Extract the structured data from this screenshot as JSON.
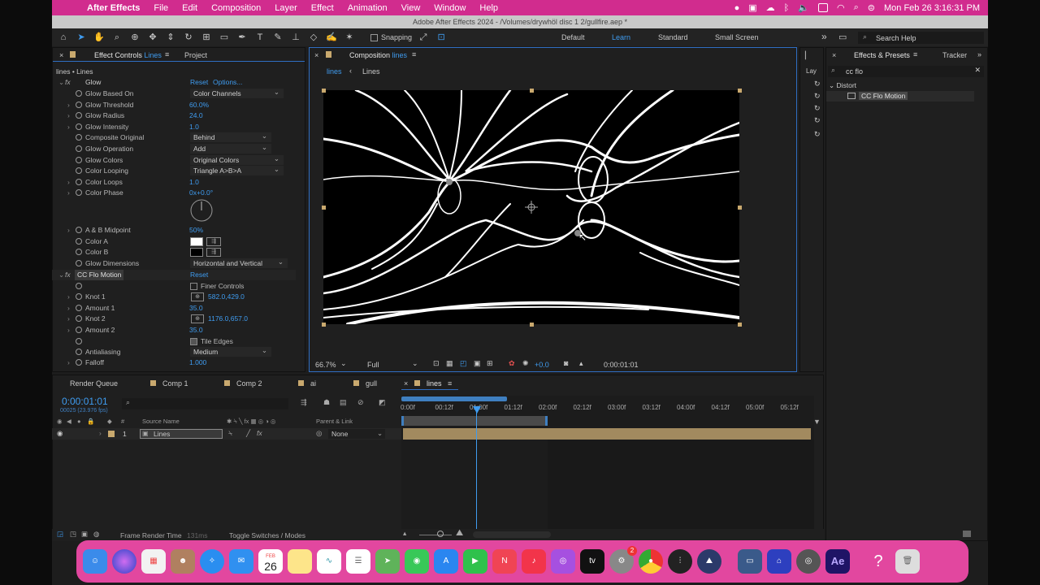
{
  "menubar": {
    "app_name": "After Effects",
    "items": [
      "File",
      "Edit",
      "Composition",
      "Layer",
      "Effect",
      "Animation",
      "View",
      "Window",
      "Help"
    ],
    "clock": "Mon Feb 26  3:16:31 PM"
  },
  "window_title": "Adobe After Effects 2024 - /Volumes/drywhöl disc 1 2/gullfire.aep *",
  "toolbar": {
    "snapping_label": "Snapping",
    "workspaces": [
      "Default",
      "Learn",
      "Standard",
      "Small Screen"
    ],
    "active_workspace": "Learn",
    "search_placeholder": "Search Help"
  },
  "effect_controls": {
    "tab_label": "Effect Controls",
    "tab_layer": "Lines",
    "project_tab": "Project",
    "breadcrumb": "lines • Lines",
    "glow": {
      "name": "Glow",
      "reset": "Reset",
      "options": "Options...",
      "props": [
        {
          "name": "Glow Based On",
          "type": "dropdown",
          "value": "Color Channels"
        },
        {
          "name": "Glow Threshold",
          "type": "value",
          "value": "60.0%"
        },
        {
          "name": "Glow Radius",
          "type": "value",
          "value": "24.0"
        },
        {
          "name": "Glow Intensity",
          "type": "value",
          "value": "1.0"
        },
        {
          "name": "Composite Original",
          "type": "dropdown",
          "value": "Behind"
        },
        {
          "name": "Glow Operation",
          "type": "dropdown",
          "value": "Add"
        },
        {
          "name": "Glow Colors",
          "type": "dropdown",
          "value": "Original Colors"
        },
        {
          "name": "Color Looping",
          "type": "dropdown",
          "value": "Triangle A>B>A"
        },
        {
          "name": "Color Loops",
          "type": "value",
          "value": "1.0"
        },
        {
          "name": "Color Phase",
          "type": "value",
          "value": "0x+0.0°"
        }
      ],
      "props2": [
        {
          "name": "A & B Midpoint",
          "type": "value",
          "value": "50%"
        },
        {
          "name": "Color A",
          "type": "swatch",
          "value": "#ffffff"
        },
        {
          "name": "Color B",
          "type": "swatch",
          "value": "#000000"
        },
        {
          "name": "Glow Dimensions",
          "type": "dropdown",
          "value": "Horizontal and Vertical"
        }
      ]
    },
    "flo": {
      "name": "CC Flo Motion",
      "reset": "Reset",
      "finer_controls": "Finer Controls",
      "props": [
        {
          "name": "Knot 1",
          "type": "point",
          "value": "582.0,429.0"
        },
        {
          "name": "Amount 1",
          "type": "value",
          "value": "35.0"
        },
        {
          "name": "Knot 2",
          "type": "point",
          "value": "1176.0,657.0"
        },
        {
          "name": "Amount 2",
          "type": "value",
          "value": "35.0"
        }
      ],
      "tile_edges": "Tile Edges",
      "antialiasing": {
        "name": "Antialiasing",
        "value": "Medium"
      },
      "falloff": {
        "name": "Falloff",
        "value": "1.000"
      }
    }
  },
  "composition": {
    "tab_label": "Composition",
    "tab_name": "lines",
    "nav_items": [
      "lines",
      "Lines"
    ],
    "zoom": "66.7%",
    "resolution": "Full",
    "exposure": "+0.0",
    "timecode": "0:00:01:01"
  },
  "effects_presets": {
    "tab_label": "Effects & Presets",
    "tracker_tab": "Tracker",
    "search_value": "cc flo",
    "category": "Distort",
    "result": "CC Flo Motion",
    "layer_tab": "Lay"
  },
  "timeline": {
    "tabs": [
      "Render Queue",
      "Comp 1",
      "Comp 2",
      "ai",
      "gull",
      "lines"
    ],
    "active_tab": "lines",
    "timecode": "0:00:01:01",
    "fps": "00025 (23.976 fps)",
    "columns": {
      "source": "Source Name",
      "parent": "Parent & Link"
    },
    "layer": {
      "index": "1",
      "name": "Lines",
      "parent": "None"
    },
    "ruler": [
      "0:00f",
      "00:12f",
      "01:00f",
      "01:12f",
      "02:00f",
      "02:12f",
      "03:00f",
      "03:12f",
      "04:00f",
      "04:12f",
      "05:00f",
      "05:12f"
    ],
    "footer": {
      "render_time_label": "Frame Render Time",
      "render_time": "131ms",
      "toggle": "Toggle Switches / Modes"
    }
  },
  "dock": {
    "apps": [
      "finder-icon",
      "siri-icon",
      "launchpad-icon",
      "contacts-icon",
      "safari-icon",
      "mail-icon",
      "calendar-icon",
      "notes-icon",
      "freeform-icon",
      "reminders-icon",
      "maps-icon",
      "messages-icon",
      "appstore-icon",
      "facetime-icon",
      "news-icon",
      "music-icon",
      "podcasts-icon",
      "appletv-icon",
      "settings-icon",
      "chrome-icon",
      "audio-icon",
      "vpn-icon",
      "screenshot-icon",
      "aftereffects-icon-2",
      "quicktime-icon",
      "aftereffects-icon",
      "help-icon",
      "trash-icon"
    ],
    "calendar_month": "FEB",
    "calendar_day": "26",
    "badge": "2",
    "ae_label": "Ae"
  }
}
